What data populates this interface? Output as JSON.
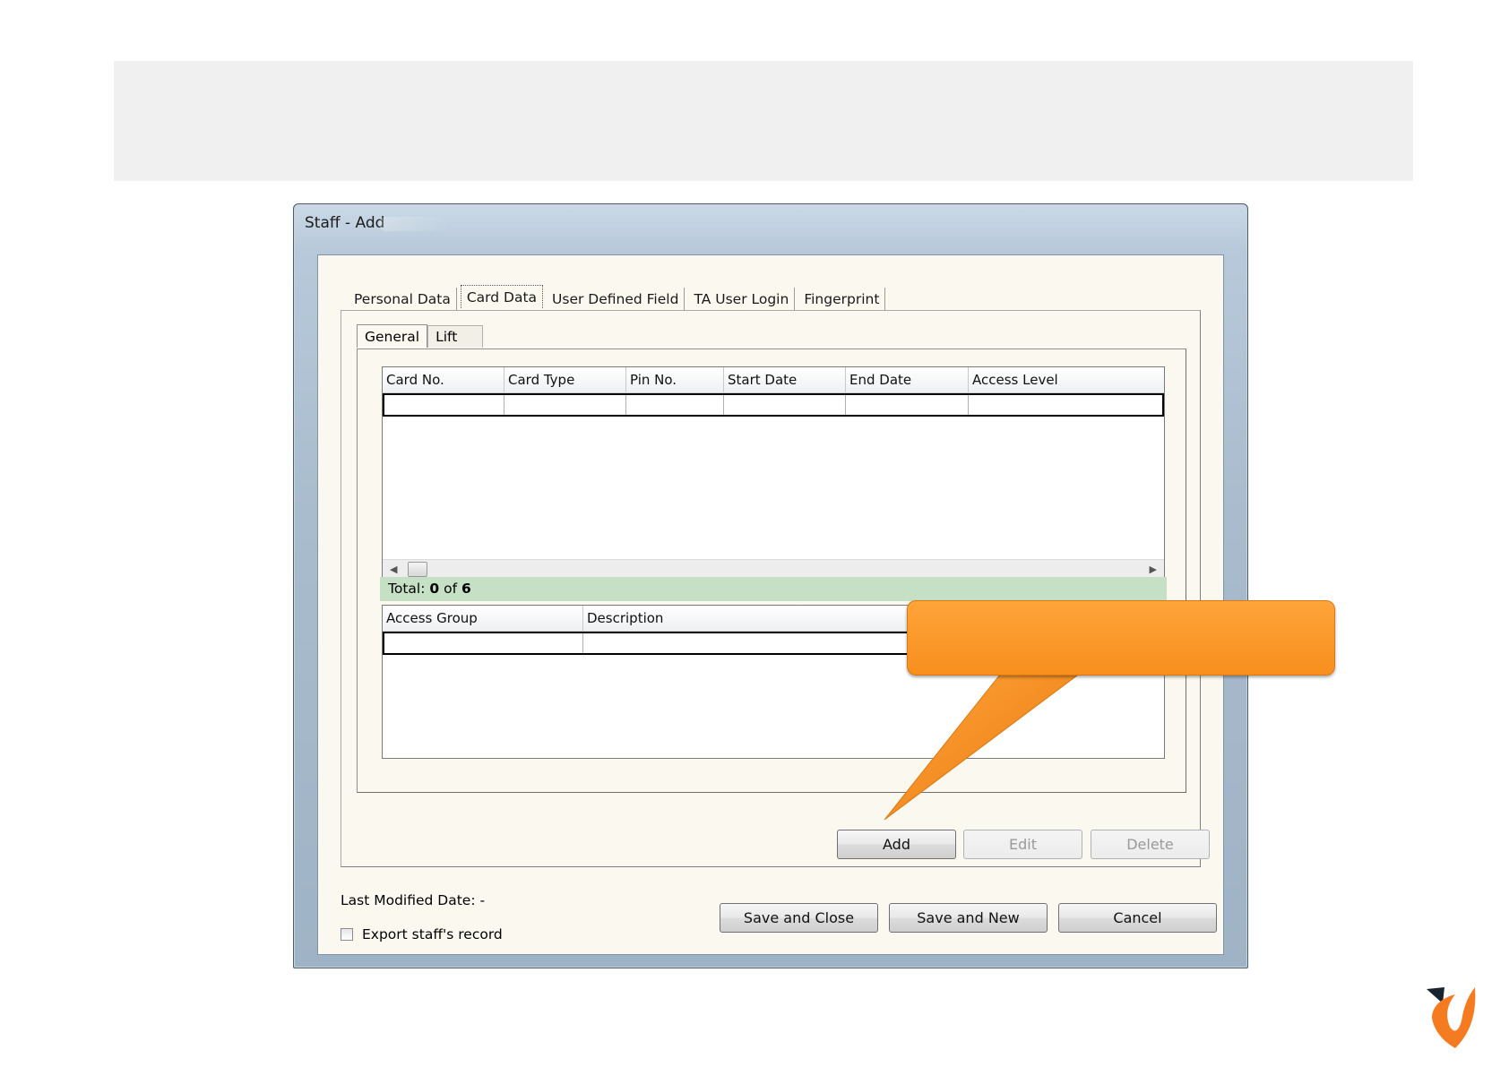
{
  "window": {
    "title": "Staff - Add"
  },
  "tabs": [
    {
      "label": "Personal Data"
    },
    {
      "label": "Card Data"
    },
    {
      "label": "User Defined Field"
    },
    {
      "label": "TA User Login"
    },
    {
      "label": "Fingerprint"
    }
  ],
  "subtabs": [
    {
      "label": "General"
    },
    {
      "label": "Lift"
    }
  ],
  "card_grid": {
    "columns": [
      "Card No.",
      "Card Type",
      "Pin No.",
      "Start Date",
      "End Date",
      "Access Level"
    ]
  },
  "total": {
    "prefix": "Total:",
    "shown": "0",
    "of": "of",
    "count": "6"
  },
  "access_grid": {
    "columns": [
      "Access Group",
      "Description"
    ]
  },
  "actions": {
    "add": "Add",
    "edit": "Edit",
    "delete": "Delete"
  },
  "footer": {
    "last_modified": "Last Modified Date: -",
    "export_label": "Export staff's record",
    "save_close": "Save and Close",
    "save_new": "Save and New",
    "cancel": "Cancel"
  },
  "colors": {
    "callout": "#f7931e",
    "total_bar": "#c6e0c6",
    "banner": "#f0f0f0"
  }
}
